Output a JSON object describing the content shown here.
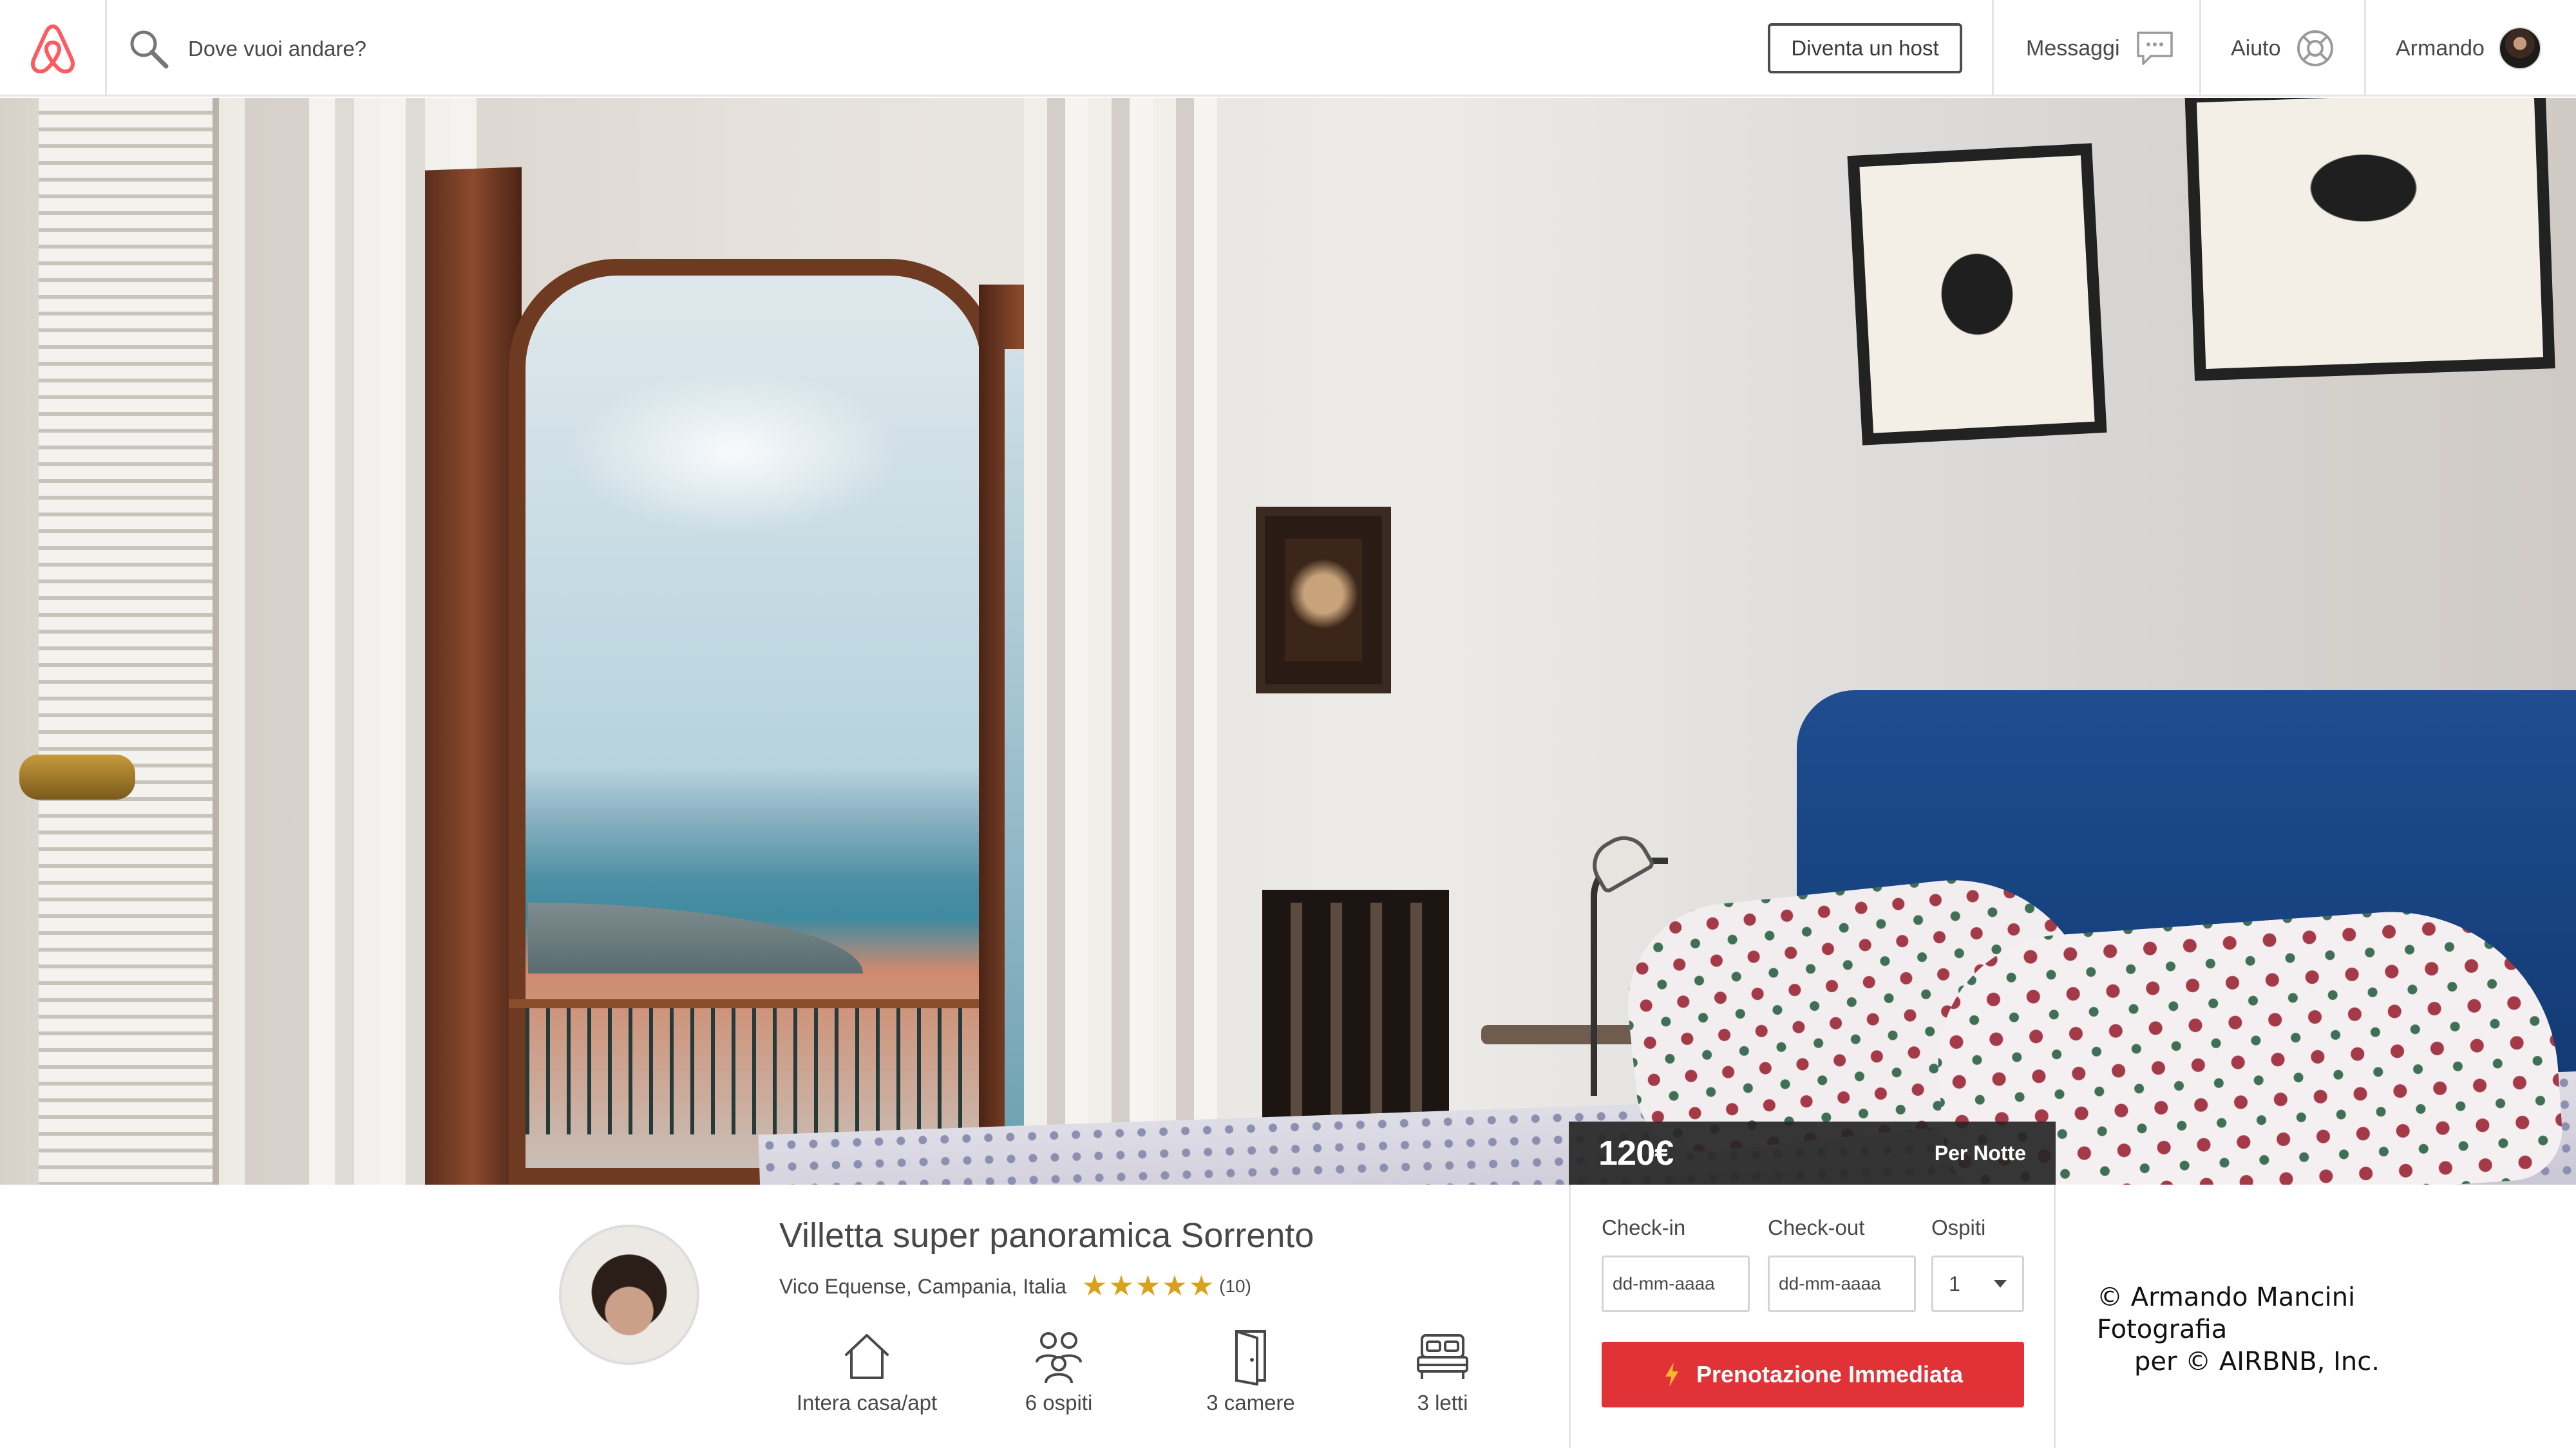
{
  "header": {
    "search_placeholder": "Dove vuoi andare?",
    "host_button": "Diventa un host",
    "messages": "Messaggi",
    "help": "Aiuto",
    "user_name": "Armando"
  },
  "listing": {
    "price": "120€",
    "per_night": "Per Notte",
    "title": "Villetta super panoramica Sorrento",
    "location": "Vico Equense, Campania, Italia",
    "rating": 5,
    "stars": "★★★★★",
    "reviews": "(10)",
    "amenities": [
      {
        "icon": "house-icon",
        "label": "Intera casa/apt"
      },
      {
        "icon": "guests-icon",
        "label": "6 ospiti"
      },
      {
        "icon": "door-icon",
        "label": "3 camere"
      },
      {
        "icon": "bed-icon",
        "label": "3 letti"
      }
    ]
  },
  "booking": {
    "checkin_label": "Check-in",
    "checkout_label": "Check-out",
    "guests_label": "Ospiti",
    "date_placeholder": "dd-mm-aaaa",
    "guests_value": "1",
    "book_button": "Prenotazione Immediata"
  },
  "watermark": {
    "line1": "© Armando Mancini Fotografia",
    "line2": "per © AIRBNB, Inc."
  },
  "colors": {
    "brand": "#ff5a5f",
    "book_button": "#e03237",
    "star": "#d9a21b",
    "price_bar": "#262626"
  }
}
